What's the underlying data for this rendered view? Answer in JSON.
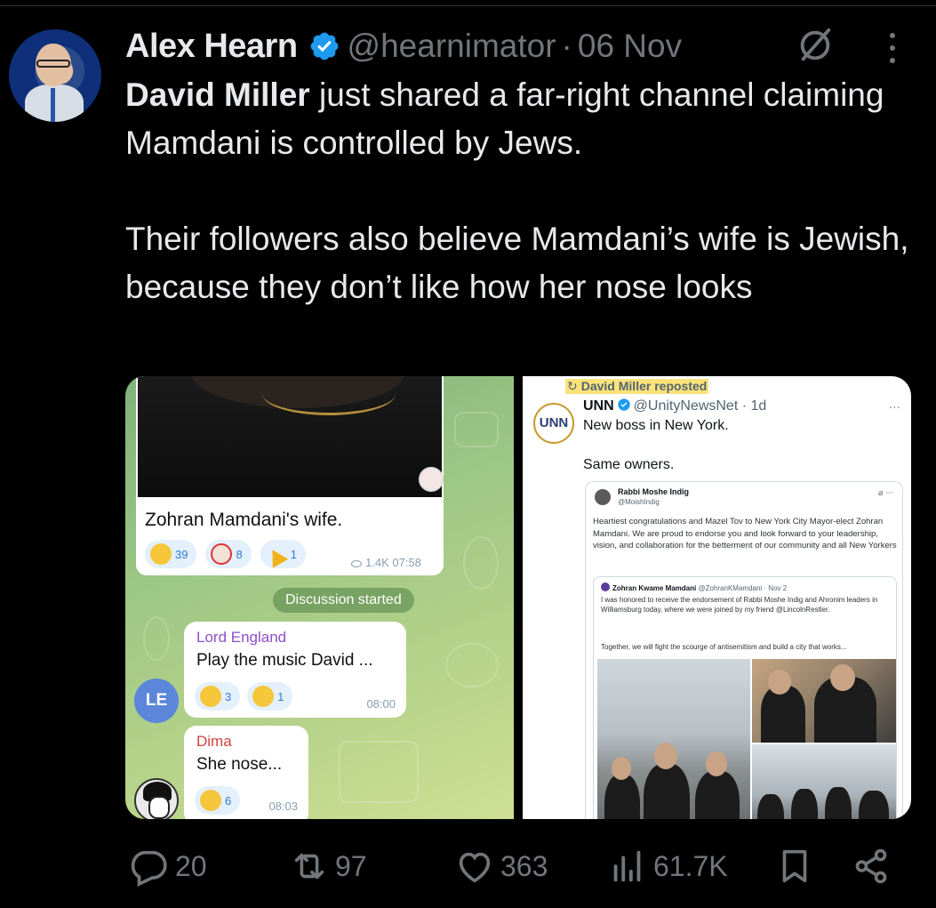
{
  "tweet": {
    "author_name": "Alex Hearn",
    "handle": "@hearnimator",
    "separator": "·",
    "date": "06 Nov",
    "text_mention": "David Miller",
    "text_line1_rest": " just shared a far-right channel claiming Mamdani is controlled by Jews.",
    "text_para2": "Their followers also believe Mamdani’s wife is Jewish, because they don’t like how her nose looks",
    "avatar_icon": "user-avatar",
    "verified_icon": "verified-badge-icon",
    "accent_color": "#1d9bf0"
  },
  "telegram": {
    "photo_caption": "Zohran Mamdani's wife.",
    "reactions": [
      {
        "emoji": "grinning",
        "count": "39"
      },
      {
        "emoji": "clown",
        "count": "8"
      },
      {
        "emoji": "party",
        "count": "1"
      }
    ],
    "views_time": "1.4K 07:58",
    "discussion_pill": "Discussion started",
    "messages": [
      {
        "author": "Lord England",
        "avatar_initials": "LE",
        "text": "Play the music David ...",
        "reactions": [
          {
            "emoji": "grinning",
            "count": "3"
          },
          {
            "emoji": "rofl",
            "count": "1"
          }
        ],
        "time": "08:00"
      },
      {
        "author": "Dima",
        "text": "She nose...",
        "reactions": [
          {
            "emoji": "rofl",
            "count": "6"
          }
        ],
        "time": "08:03"
      }
    ]
  },
  "screenshot_tweet": {
    "repost_label": "David Miller reposted",
    "repost_icon": "↻",
    "logo_text": "UNN",
    "name": "UNN",
    "handle_time": "@UnityNewsNet · 1d",
    "line1": "New boss in New York.",
    "line2": "Same owners.",
    "more": "···",
    "quote": {
      "name": "Rabbi Moshe Indig",
      "handle": "@MoishIndig",
      "icons": "⌀ ···",
      "text": "Heartiest congratulations and Mazel Tov to New York City Mayor-elect Zohran Mamdani. We are proud to endorse you and look forward to your leadership, vision, and collaboration for the betterment of our community and all New Yorkers",
      "inner": {
        "name": "Zohran Kwame Mamdani",
        "handle_time": "@ZohranKMamdani · Nov 2",
        "text": "I was honored to receive the endorsement of Rabbi Moshe Indig and Ahronim leaders in Williamsburg today, where we were joined by my friend @LincolnRestler.",
        "text2": "Together, we will fight the scourge of antisemitism and build a city that works..."
      }
    }
  },
  "actions": {
    "replies": "20",
    "reposts": "97",
    "likes": "363",
    "views": "61.7K"
  }
}
